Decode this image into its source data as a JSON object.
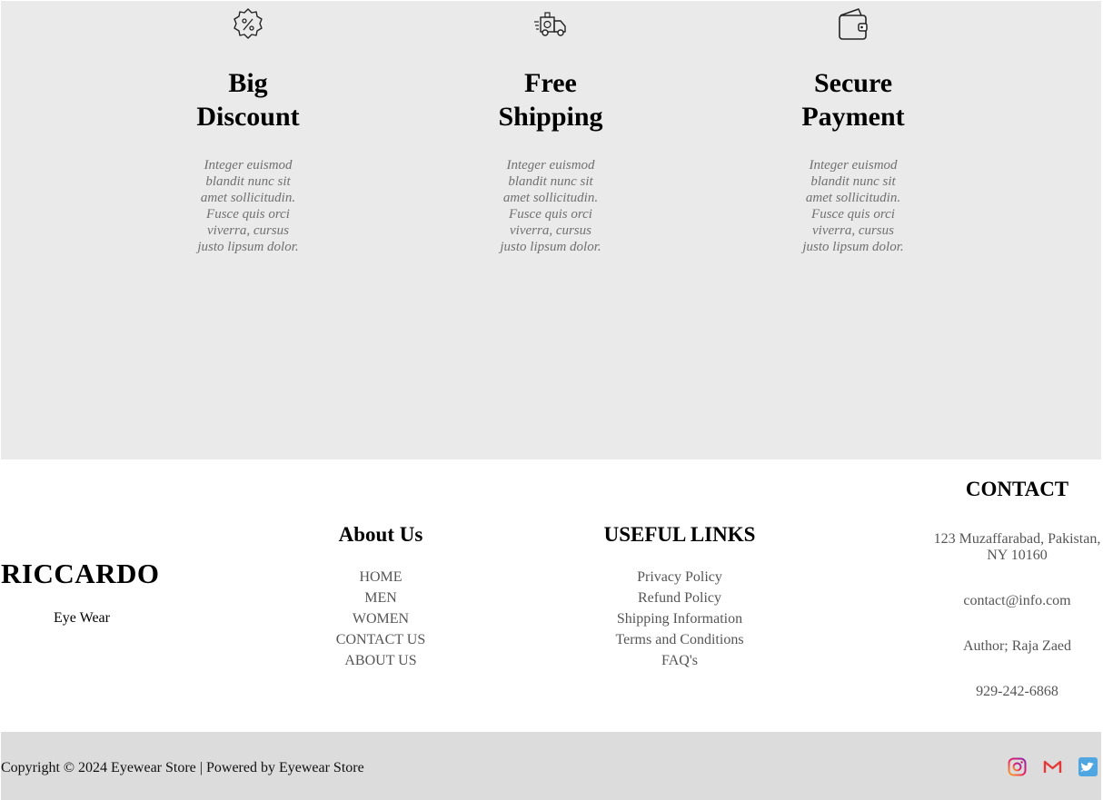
{
  "features": [
    {
      "icon": "discount-badge-icon",
      "title_line1": "Big",
      "title_line2": "Discount",
      "text": "Integer euismod blandit nunc sit amet sollicitudin. Fusce quis orci viverra, cursus justo lipsum dolor."
    },
    {
      "icon": "delivery-truck-icon",
      "title_line1": "Free",
      "title_line2": "Shipping",
      "text": "Integer euismod blandit nunc sit amet sollicitudin. Fusce quis orci viverra, cursus justo lipsum dolor."
    },
    {
      "icon": "wallet-icon",
      "title_line1": "Secure",
      "title_line2": "Payment",
      "text": "Integer euismod blandit nunc sit amet sollicitudin. Fusce quis orci viverra, cursus justo lipsum dolor."
    }
  ],
  "brand": {
    "name": "RICCARDO",
    "tagline": "Eye Wear"
  },
  "about": {
    "heading": "About Us",
    "links": [
      "HOME",
      "MEN",
      "WOMEN",
      "CONTACT US",
      "ABOUT US"
    ]
  },
  "useful": {
    "heading": "USEFUL LINKS",
    "links": [
      "Privacy Policy",
      "Refund Policy",
      "Shipping Information",
      "Terms and Conditions",
      "FAQ's"
    ]
  },
  "contact": {
    "heading": "CONTACT",
    "address_line1": "123 Muzaffarabad, Pakistan,",
    "address_line2": "NY 10160",
    "email": "contact@info.com",
    "author": "Author; Raja Zaed",
    "phone": "929-242-6868"
  },
  "footer": {
    "copyright": "Copyright © 2024 Eyewear Store | Powered by Eyewear Store",
    "socials": [
      "instagram-icon",
      "gmail-icon",
      "twitter-icon"
    ]
  },
  "colors": {
    "features_bg": "#e9eae9",
    "bottombar_bg": "#dcdcdc",
    "muted_text": "#707070"
  }
}
